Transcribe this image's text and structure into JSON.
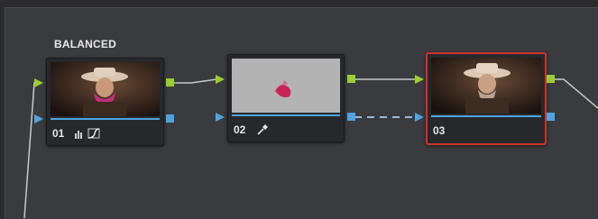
{
  "graph": {
    "group_label": "BALANCED",
    "nodes": [
      {
        "label": "01",
        "tools": [
          "histogram-icon",
          "curves-icon"
        ]
      },
      {
        "label": "02",
        "tools": [
          "eyedropper-icon"
        ]
      },
      {
        "label": "03",
        "tools": [],
        "selected": true
      }
    ]
  },
  "colors": {
    "background": "#3a3b3e",
    "rgb_port": "#9acd32",
    "alpha_port": "#4fa3e0",
    "selection": "#d0312d"
  }
}
